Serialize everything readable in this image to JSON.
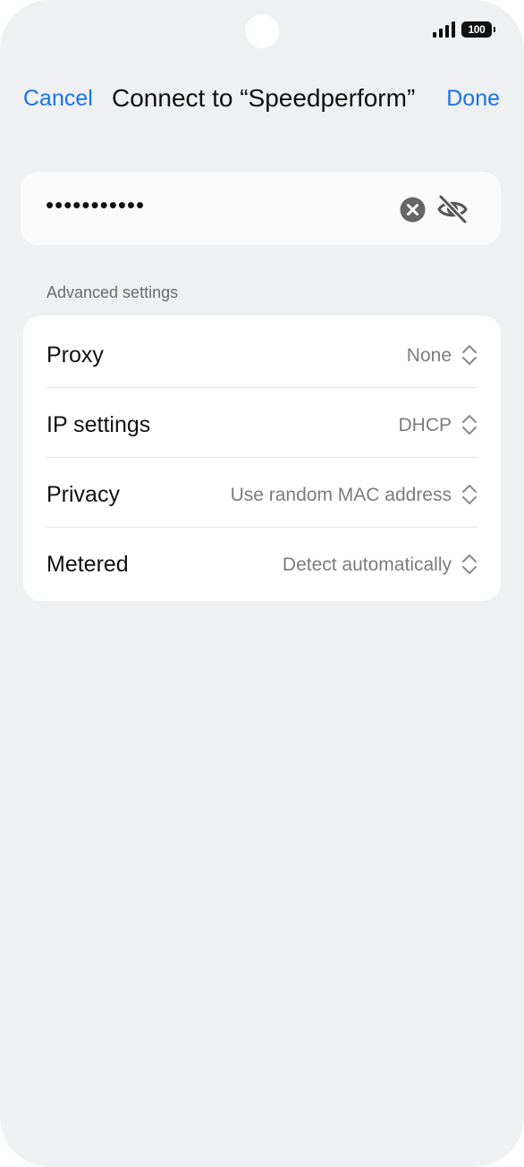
{
  "status_bar": {
    "battery_level": "100",
    "signal_icon": "signal-icon"
  },
  "nav": {
    "cancel_label": "Cancel",
    "title": "Connect to “Speedperform”",
    "done_label": "Done"
  },
  "password": {
    "masked_value": "•••••••••••",
    "clear_icon": "clear-icon",
    "visibility_icon": "eye-off-icon"
  },
  "advanced": {
    "section_label": "Advanced settings",
    "rows": [
      {
        "label": "Proxy",
        "value": "None"
      },
      {
        "label": "IP settings",
        "value": "DHCP"
      },
      {
        "label": "Privacy",
        "value": "Use random MAC address"
      },
      {
        "label": "Metered",
        "value": "Detect automatically"
      }
    ]
  },
  "colors": {
    "accent": "#1a73e8",
    "background": "#eff0f2",
    "card": "#ffffff",
    "secondary_text": "#7c7c80"
  }
}
